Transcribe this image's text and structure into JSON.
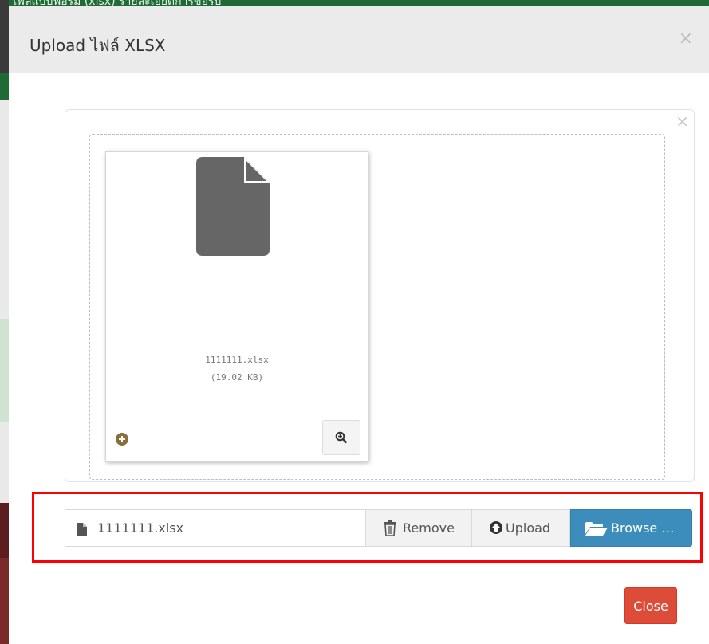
{
  "background": {
    "partial_heading": "ไฟล์แบบฟอร์ม (xlsx) รายละเอียดการขอรับ"
  },
  "modal": {
    "title": "Upload ไฟล์ XLSX",
    "close_symbol": "×"
  },
  "preview": {
    "close_symbol": "×",
    "file_name": "1111111.xlsx",
    "file_size": "(19.02 KB)",
    "icons": {
      "file": "file-icon",
      "add": "plus-circle-icon",
      "zoom": "zoom-in-icon"
    }
  },
  "file_input": {
    "caption": "1111111.xlsx",
    "remove_label": "Remove",
    "upload_label": "Upload",
    "browse_label": "Browse …",
    "icons": {
      "caption": "file-icon",
      "remove": "trash-icon",
      "upload": "upload-circle-icon",
      "browse": "folder-open-icon"
    }
  },
  "footer": {
    "close_label": "Close"
  },
  "colors": {
    "highlight": "#ff0000",
    "browse": "#3c8dbc",
    "close": "#dd4b39",
    "header_bg": "#ebebeb"
  }
}
